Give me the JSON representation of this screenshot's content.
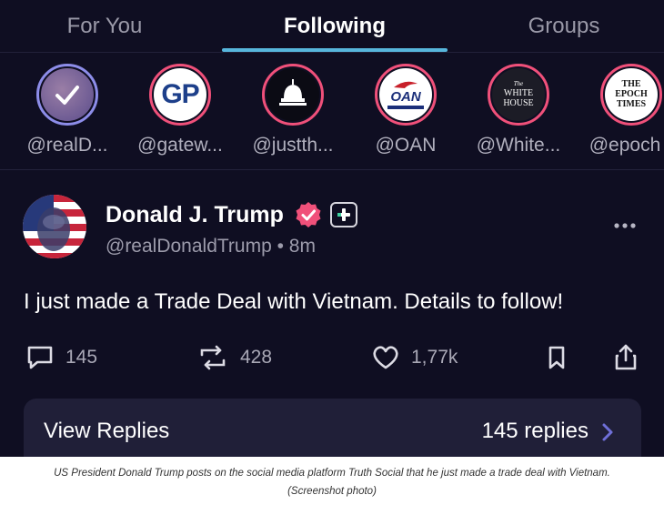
{
  "tabs": [
    {
      "label": "For You",
      "active": false
    },
    {
      "label": "Following",
      "active": true
    },
    {
      "label": "Groups",
      "active": false
    }
  ],
  "accounts": [
    {
      "handle": "@realD...",
      "ring": "blue",
      "avatar": "checkmark-portrait"
    },
    {
      "handle": "@gatew...",
      "ring": "red",
      "avatar_text": "GP"
    },
    {
      "handle": "@justth...",
      "ring": "red",
      "avatar": "capitol-dome"
    },
    {
      "handle": "@OAN",
      "ring": "red",
      "avatar_text": "OAN"
    },
    {
      "handle": "@White...",
      "ring": "red",
      "avatar_text": [
        "The",
        "WHITE",
        "HOUSE"
      ]
    },
    {
      "handle": "@epoch",
      "ring": "red",
      "avatar_text": [
        "THE",
        "EPOCH",
        "TIMES"
      ]
    }
  ],
  "post": {
    "author": "Donald J. Trump",
    "meta": "@realDonaldTrump • 8m",
    "text": "I just made a Trade Deal with Vietnam. Details to follow!",
    "actions": {
      "replies": "145",
      "retruths": "428",
      "likes": "1,77k"
    }
  },
  "replies_card": {
    "label": "View Replies",
    "count": "145 replies"
  },
  "caption": {
    "line1": "US President Donald Trump posts on the social media platform Truth Social that he just made a trade deal with Vietnam.",
    "line2": "(Screenshot photo)"
  },
  "colors": {
    "background": "#0f0e22",
    "tab_underline": "#57b6dc",
    "ring_red": "#f0507a",
    "ring_blue": "#8d8de9",
    "verified": "#f0507a",
    "card": "#201f38"
  }
}
